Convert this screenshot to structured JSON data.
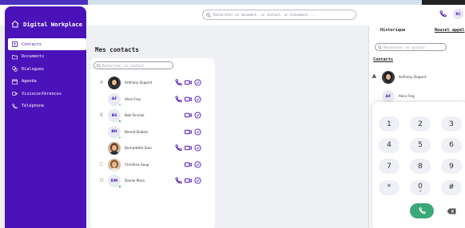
{
  "app": {
    "title": "Digital Workplace"
  },
  "sidebar": {
    "items": [
      {
        "label": "Contacts",
        "icon": "contacts-icon",
        "active": true
      },
      {
        "label": "Documents",
        "icon": "folder-icon",
        "active": false
      },
      {
        "label": "Dialogues",
        "icon": "chat-icon",
        "active": false
      },
      {
        "label": "Agenda",
        "icon": "calendar-icon",
        "active": false
      },
      {
        "label": "Visioconférences",
        "icon": "video-icon",
        "active": false
      },
      {
        "label": "Téléphone",
        "icon": "phone-icon",
        "active": false
      }
    ]
  },
  "header": {
    "search_placeholder": "Rechercher un document, un contact, un évènement ...",
    "user_initials": "RC"
  },
  "main": {
    "title": "Mes contacts",
    "search_placeholder": "Rechercher un contact",
    "contacts": [
      {
        "letter": "A",
        "initials": "",
        "photo": true,
        "name": "Anthony Dupont",
        "phone": true
      },
      {
        "letter": "",
        "initials": "AF",
        "photo": false,
        "name": "Alice Frey",
        "phone": true
      },
      {
        "letter": "B",
        "initials": "BS",
        "photo": false,
        "name": "Bob Sinclair",
        "phone": false
      },
      {
        "letter": "",
        "initials": "BD",
        "photo": false,
        "name": "Benoit Dubois",
        "phone": false
      },
      {
        "letter": "",
        "initials": "",
        "photo": true,
        "name": "Bernadette Soio",
        "phone": true
      },
      {
        "letter": "C",
        "initials": "",
        "photo": true,
        "name": "Christine Soup",
        "phone": false
      },
      {
        "letter": "D",
        "initials": "DM",
        "photo": false,
        "name": "Daniel Maro",
        "phone": true
      }
    ]
  },
  "right_panel": {
    "tab_history": "Historique",
    "tab_new_call": "Nouvel appel",
    "search_placeholder": "Rechercher un contact",
    "heading": "Contacts",
    "contacts": [
      {
        "letter": "A",
        "initials": "",
        "photo": true,
        "name": "Anthony Dupont"
      },
      {
        "letter": "",
        "initials": "AF",
        "photo": false,
        "name": "Alice Frey"
      }
    ]
  },
  "dialpad": {
    "keys": [
      {
        "main": "1",
        "sub": ""
      },
      {
        "main": "2",
        "sub": ""
      },
      {
        "main": "3",
        "sub": ""
      },
      {
        "main": "4",
        "sub": ""
      },
      {
        "main": "5",
        "sub": ""
      },
      {
        "main": "6",
        "sub": ""
      },
      {
        "main": "7",
        "sub": ""
      },
      {
        "main": "8",
        "sub": ""
      },
      {
        "main": "9",
        "sub": ""
      },
      {
        "main": "*",
        "sub": ""
      },
      {
        "main": "0",
        "sub": "+"
      },
      {
        "main": "#",
        "sub": ""
      }
    ]
  },
  "colors": {
    "brand": "#4a12b8",
    "call": "#3aa877",
    "online": "#3d9b3d"
  }
}
